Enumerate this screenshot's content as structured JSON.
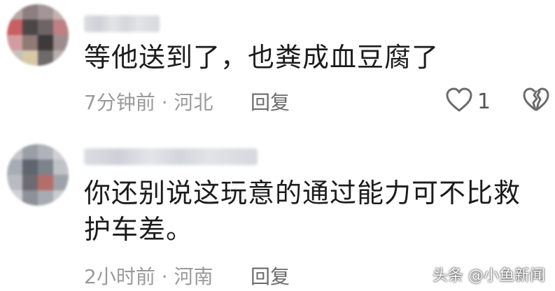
{
  "comments": [
    {
      "text": "等他送到了，也粪成血豆腐了",
      "time_location": "7分钟前 · 河北",
      "reply_label": "回复",
      "like_count": "1"
    },
    {
      "text": "你还别说这玩意的通过能力可不比救护车差。",
      "time_location": "2小时前 · 河南",
      "reply_label": "回复"
    }
  ],
  "watermark": "头条 @小鱼新闻",
  "colors": {
    "text_primary": "#1c1c1c",
    "text_meta": "#9a9a9a",
    "icon_stroke": "#6b6b6b"
  }
}
